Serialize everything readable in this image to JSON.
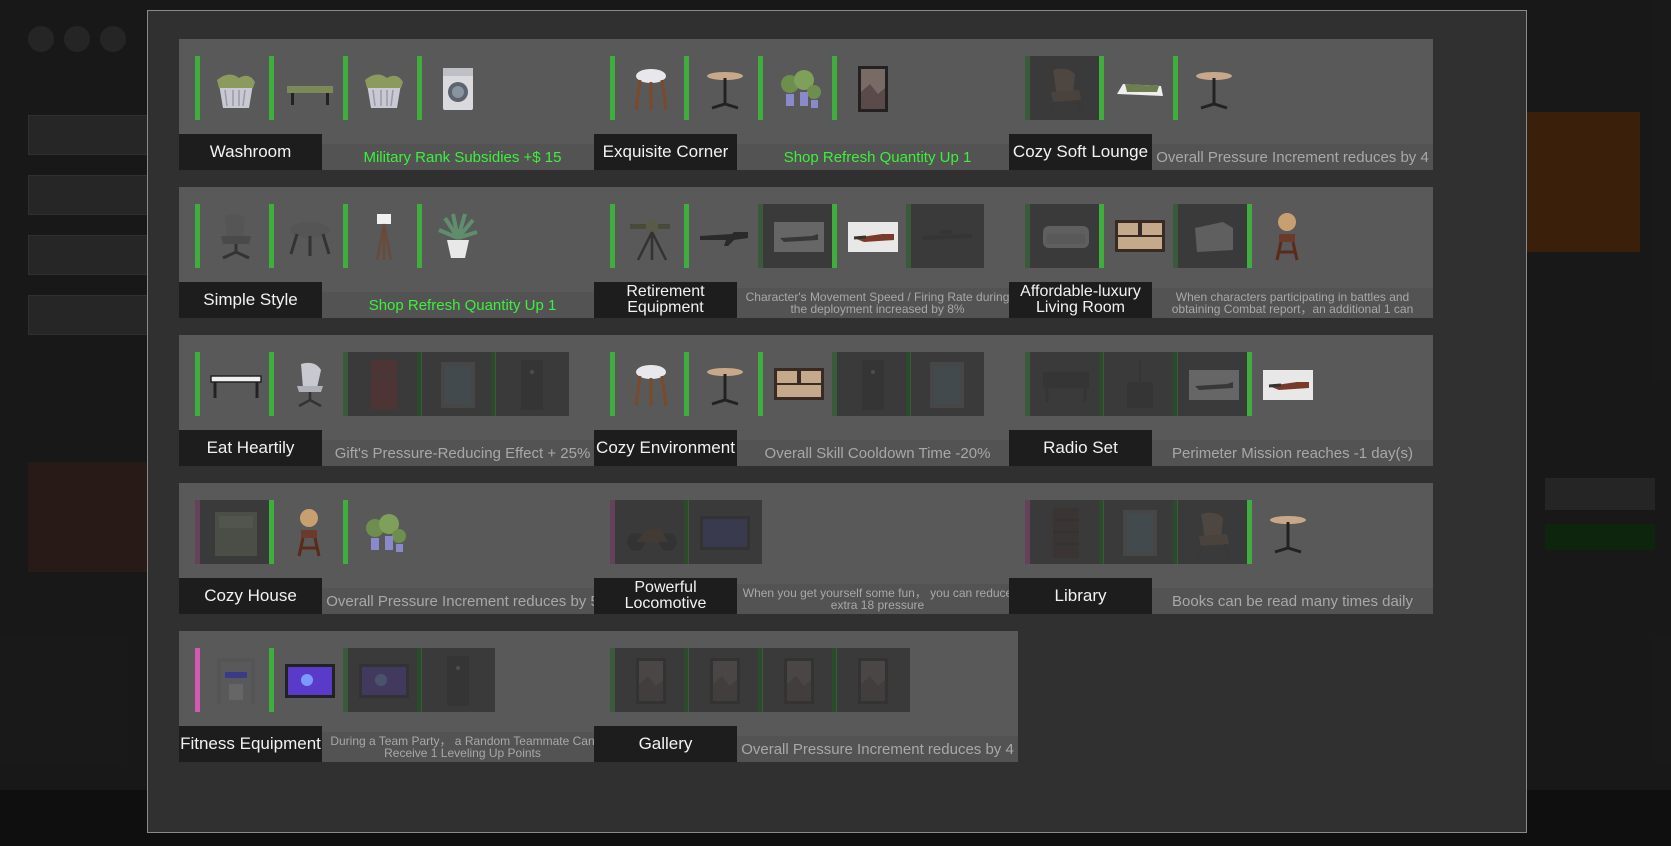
{
  "sets": [
    {
      "name": "Washroom",
      "effect": "Military Rank Subsidies +$  15",
      "active": true,
      "slots": [
        {
          "icon": "laundry-basket-icon",
          "on": true
        },
        {
          "icon": "bench-icon",
          "on": true
        },
        {
          "icon": "laundry-basket-icon",
          "on": true
        },
        {
          "icon": "washing-machine-icon",
          "on": true
        }
      ]
    },
    {
      "name": "Exquisite Corner",
      "effect": "Shop Refresh Quantity Up   1",
      "active": true,
      "slots": [
        {
          "icon": "stool-icon",
          "on": true
        },
        {
          "icon": "round-table-icon",
          "on": true
        },
        {
          "icon": "potted-plants-icon",
          "on": true
        },
        {
          "icon": "painting-icon",
          "on": true
        }
      ]
    },
    {
      "name": "Cozy Soft Lounge",
      "effect": "Overall Pressure Increment reduces by   4",
      "active": false,
      "slots": [
        {
          "icon": "armchair-icon",
          "on": false
        },
        {
          "icon": "cushion-icon",
          "on": true
        },
        {
          "icon": "round-table-icon",
          "on": true
        }
      ]
    },
    {
      "name": "Simple Style",
      "effect": "Shop Refresh Quantity Up   1",
      "active": true,
      "slots": [
        {
          "icon": "office-chair-icon",
          "on": true
        },
        {
          "icon": "ottoman-icon",
          "on": true
        },
        {
          "icon": "floor-lamp-icon",
          "on": true
        },
        {
          "icon": "potted-plant-icon",
          "on": true
        }
      ]
    },
    {
      "name": "Retirement Equipment",
      "effect": "Character's Movement Speed / Firing Rate during the deployment increased by   8%",
      "active": false,
      "small": true,
      "slots": [
        {
          "icon": "mounted-gun-icon",
          "on": true
        },
        {
          "icon": "rifle-icon",
          "on": true
        },
        {
          "icon": "gun-case-icon",
          "on": false
        },
        {
          "icon": "weapon-rack-icon",
          "on": true
        },
        {
          "icon": "sniper-rifle-icon",
          "on": false
        }
      ]
    },
    {
      "name": "Affordable-luxury Living Room",
      "effect": "When characters participating in battles and obtaining Combat report，an additional   1 can",
      "active": false,
      "small": true,
      "slots": [
        {
          "icon": "sofa-icon",
          "on": false
        },
        {
          "icon": "dresser-icon",
          "on": true
        },
        {
          "icon": "sofa-chair-icon",
          "on": false
        },
        {
          "icon": "gramophone-icon",
          "on": true
        }
      ]
    },
    {
      "name": "Eat Heartily",
      "effect": "Gift's Pressure-Reducing Effect +  25%",
      "active": false,
      "slots": [
        {
          "icon": "dining-table-icon",
          "on": true
        },
        {
          "icon": "swivel-chair-icon",
          "on": true
        },
        {
          "icon": "fridge-icon",
          "on": false
        },
        {
          "icon": "cabinet-icon",
          "on": false
        },
        {
          "icon": "locker-icon",
          "on": false
        }
      ]
    },
    {
      "name": "Cozy Environment",
      "effect": "Overall Skill Cooldown Time   -20%",
      "active": false,
      "slots": [
        {
          "icon": "stool-icon",
          "on": true
        },
        {
          "icon": "round-table-icon",
          "on": true
        },
        {
          "icon": "dresser-icon",
          "on": true
        },
        {
          "icon": "locker-icon",
          "on": false
        },
        {
          "icon": "cabinet-icon",
          "on": false
        }
      ]
    },
    {
      "name": "Radio Set",
      "effect": "Perimeter Mission reaches   -1 day(s)",
      "active": false,
      "slots": [
        {
          "icon": "radio-console-icon",
          "on": false
        },
        {
          "icon": "radio-antenna-icon",
          "on": false
        },
        {
          "icon": "gun-case-icon",
          "on": false
        },
        {
          "icon": "weapon-rack-icon",
          "on": true
        }
      ]
    },
    {
      "name": "Cozy House",
      "effect": "Overall Pressure Increment reduces by   5",
      "active": false,
      "slots": [
        {
          "icon": "bed-icon",
          "on": false,
          "pink": true
        },
        {
          "icon": "gramophone-icon",
          "on": true
        },
        {
          "icon": "potted-plants-icon",
          "on": true
        }
      ]
    },
    {
      "name": "Powerful Locomotive",
      "effect": "When you get yourself some fun，  you can reduce extra   18 pressure",
      "active": false,
      "small": true,
      "slots": [
        {
          "icon": "motorcycle-icon",
          "on": false,
          "pink": true
        },
        {
          "icon": "arcade-screen-icon",
          "on": false
        }
      ]
    },
    {
      "name": "Library",
      "effect": "Books can be read many times daily",
      "active": false,
      "slots": [
        {
          "icon": "bookshelf-icon",
          "on": false,
          "pink": true
        },
        {
          "icon": "cabinet-icon",
          "on": false
        },
        {
          "icon": "armchair-icon",
          "on": false
        },
        {
          "icon": "round-table-icon",
          "on": true
        }
      ]
    },
    {
      "name": "Fitness Equipment",
      "effect": "During a Team Party，  a Random Teammate Can Receive   1 Leveling Up Points",
      "active": false,
      "small": true,
      "slots": [
        {
          "icon": "home-gym-icon",
          "on": true,
          "pink": true
        },
        {
          "icon": "tv-screen-icon",
          "on": true
        },
        {
          "icon": "tv-screen-icon",
          "on": false
        },
        {
          "icon": "locker-icon",
          "on": false
        }
      ]
    },
    {
      "name": "Gallery",
      "effect": "Overall Pressure Increment reduces by   4",
      "active": false,
      "slots": [
        {
          "icon": "painting-icon",
          "on": false
        },
        {
          "icon": "painting-icon",
          "on": false
        },
        {
          "icon": "painting-icon",
          "on": false
        },
        {
          "icon": "painting-icon",
          "on": false
        }
      ]
    }
  ],
  "colors": {
    "active_effect": "#3cf03c",
    "inactive_effect": "#a8a8a8",
    "slot_bar": "#3fae3f",
    "slot_bar_rare": "#d25ab0"
  }
}
